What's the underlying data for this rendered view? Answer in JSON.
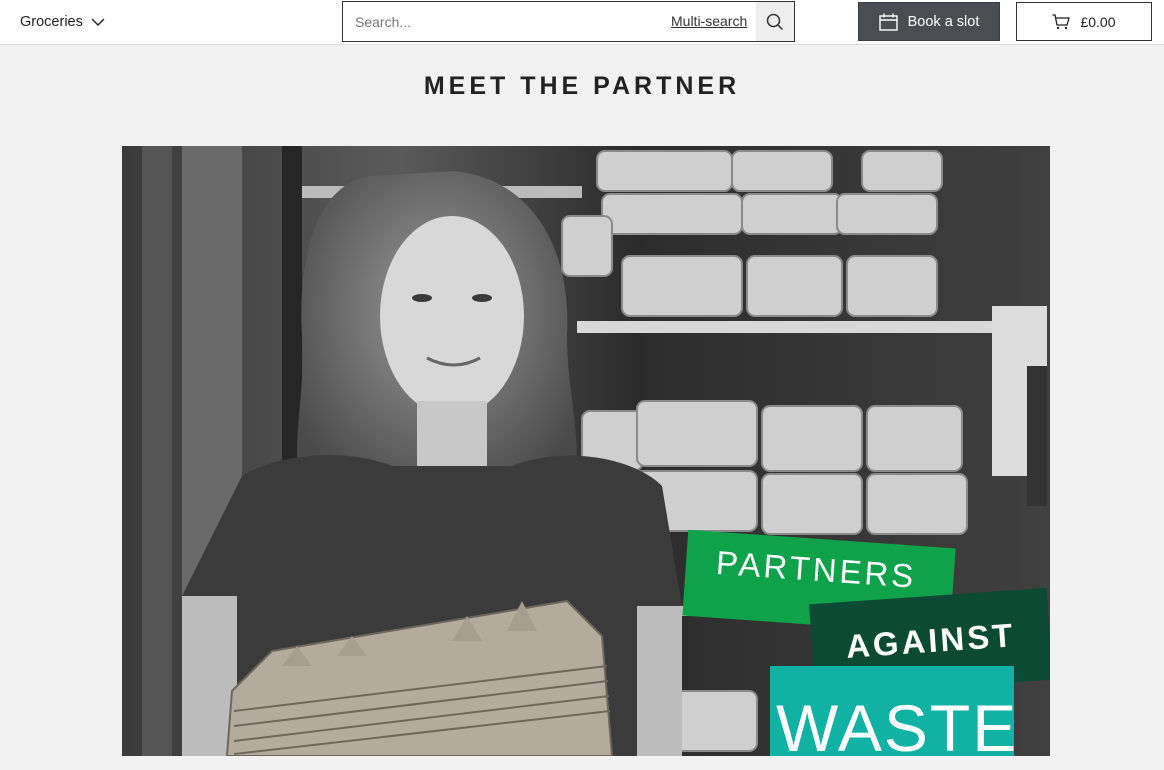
{
  "header": {
    "category_label": "Groceries",
    "search": {
      "placeholder": "Search...",
      "multi_search_label": "Multi-search"
    },
    "book_slot_label": "Book a slot",
    "basket_total": "£0.00"
  },
  "icons": {
    "category": "chevron-down-icon",
    "search": "search-icon",
    "book": "calendar-icon",
    "basket": "cart-icon"
  },
  "colors": {
    "book_button_bg": "#4a4d52",
    "partners_green": "#10a14b",
    "against_dark_green": "#0d4a33",
    "waste_teal": "#11b2a3"
  },
  "page": {
    "title": "MEET THE PARTNER",
    "hero": {
      "tag_line_1": "PARTNERS",
      "tag_line_2": "AGAINST",
      "tag_line_3": "WASTE"
    }
  }
}
